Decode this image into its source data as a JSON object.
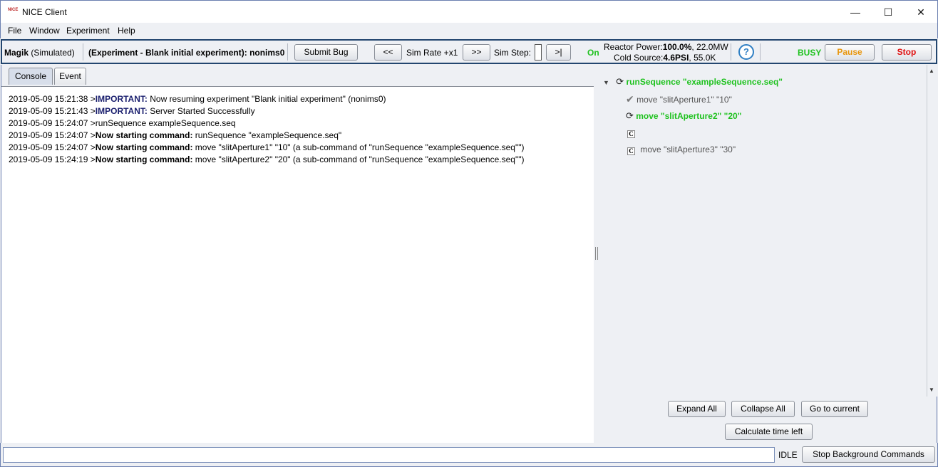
{
  "window": {
    "title": "NICE Client",
    "app_icon_text": "NICE",
    "minimize_glyph": "—",
    "maximize_glyph": "☐",
    "close_glyph": "✕"
  },
  "menu": {
    "items": [
      "File",
      "Window",
      "Experiment",
      "Help"
    ]
  },
  "toolbar": {
    "instrument_name": "Magik",
    "instrument_mode": "(Simulated)",
    "experiment_label": "(Experiment - Blank initial experiment):",
    "experiment_id": "nonims0",
    "submit_bug": "Submit Bug",
    "rate_down": "<<",
    "sim_rate": "Sim Rate +x1",
    "rate_up": ">>",
    "sim_step": "Sim Step:",
    "step_button": ">|",
    "on_status": "On",
    "reactor_power_label": "Reactor Power:",
    "reactor_power_pct": "100.0%",
    "reactor_power_mw": ", 22.0MW",
    "cold_source_label": "Cold Source:",
    "cold_source_psi": "4.6PSI",
    "cold_source_k": ", 55.0K",
    "help_glyph": "?",
    "busy_status": "BUSY",
    "pause": "Pause",
    "stop": "Stop",
    "colors": {
      "on": "#1fc21f",
      "busy": "#1fc21f",
      "pause": "#e8950a",
      "stop": "#e01010",
      "help": "#2f7fc4"
    }
  },
  "tabs": [
    "Console",
    "Event"
  ],
  "console": [
    {
      "time": "2019-05-09 15:21:38 >",
      "label": "IMPORTANT:",
      "text": " Now resuming experiment \"Blank initial experiment\" (nonims0)",
      "style": "imp"
    },
    {
      "time": "2019-05-09 15:21:43 >",
      "label": "IMPORTANT:",
      "text": " Server Started Successfully",
      "style": "imp"
    },
    {
      "time": "2019-05-09 15:24:07 >",
      "label": "",
      "text": "runSequence exampleSequence.seq",
      "style": ""
    },
    {
      "time": "2019-05-09 15:24:07 >",
      "label": "Now starting command:",
      "text": " runSequence \"exampleSequence.seq\"",
      "style": "b"
    },
    {
      "time": "2019-05-09 15:24:07 >",
      "label": "Now starting command:",
      "text": " move \"slitAperture1\" \"10\" (a sub-command of \"runSequence \"exampleSequence.seq\"\")",
      "style": "b"
    },
    {
      "time": "2019-05-09 15:24:19 >",
      "label": "Now starting command:",
      "text": " move \"slitAperture2\" \"20\" (a sub-command of \"runSequence \"exampleSequence.seq\"\")",
      "style": "b"
    }
  ],
  "tree": {
    "expander": "▼",
    "root": "runSequence \"exampleSequence.seq\"",
    "children": [
      {
        "state": "done",
        "icon": "✔",
        "text": "move \"slitAperture1\" \"10\""
      },
      {
        "state": "running",
        "icon": "⟳",
        "text": "move \"slitAperture2\" \"20\""
      },
      {
        "state": "queued",
        "icon": "C",
        "text": ""
      },
      {
        "state": "queued",
        "icon": "C",
        "text": "move \"slitAperture3\" \"30\""
      }
    ],
    "spin_icon": "⟳",
    "scroll_up": "▲",
    "scroll_down": "▼"
  },
  "tree_buttons": {
    "expand_all": "Expand All",
    "collapse_all": "Collapse All",
    "go_to_current": "Go to current",
    "calc_time": "Calculate time left"
  },
  "bottom": {
    "input_value": "",
    "status": "IDLE",
    "stop_background": "Stop Background Commands"
  }
}
